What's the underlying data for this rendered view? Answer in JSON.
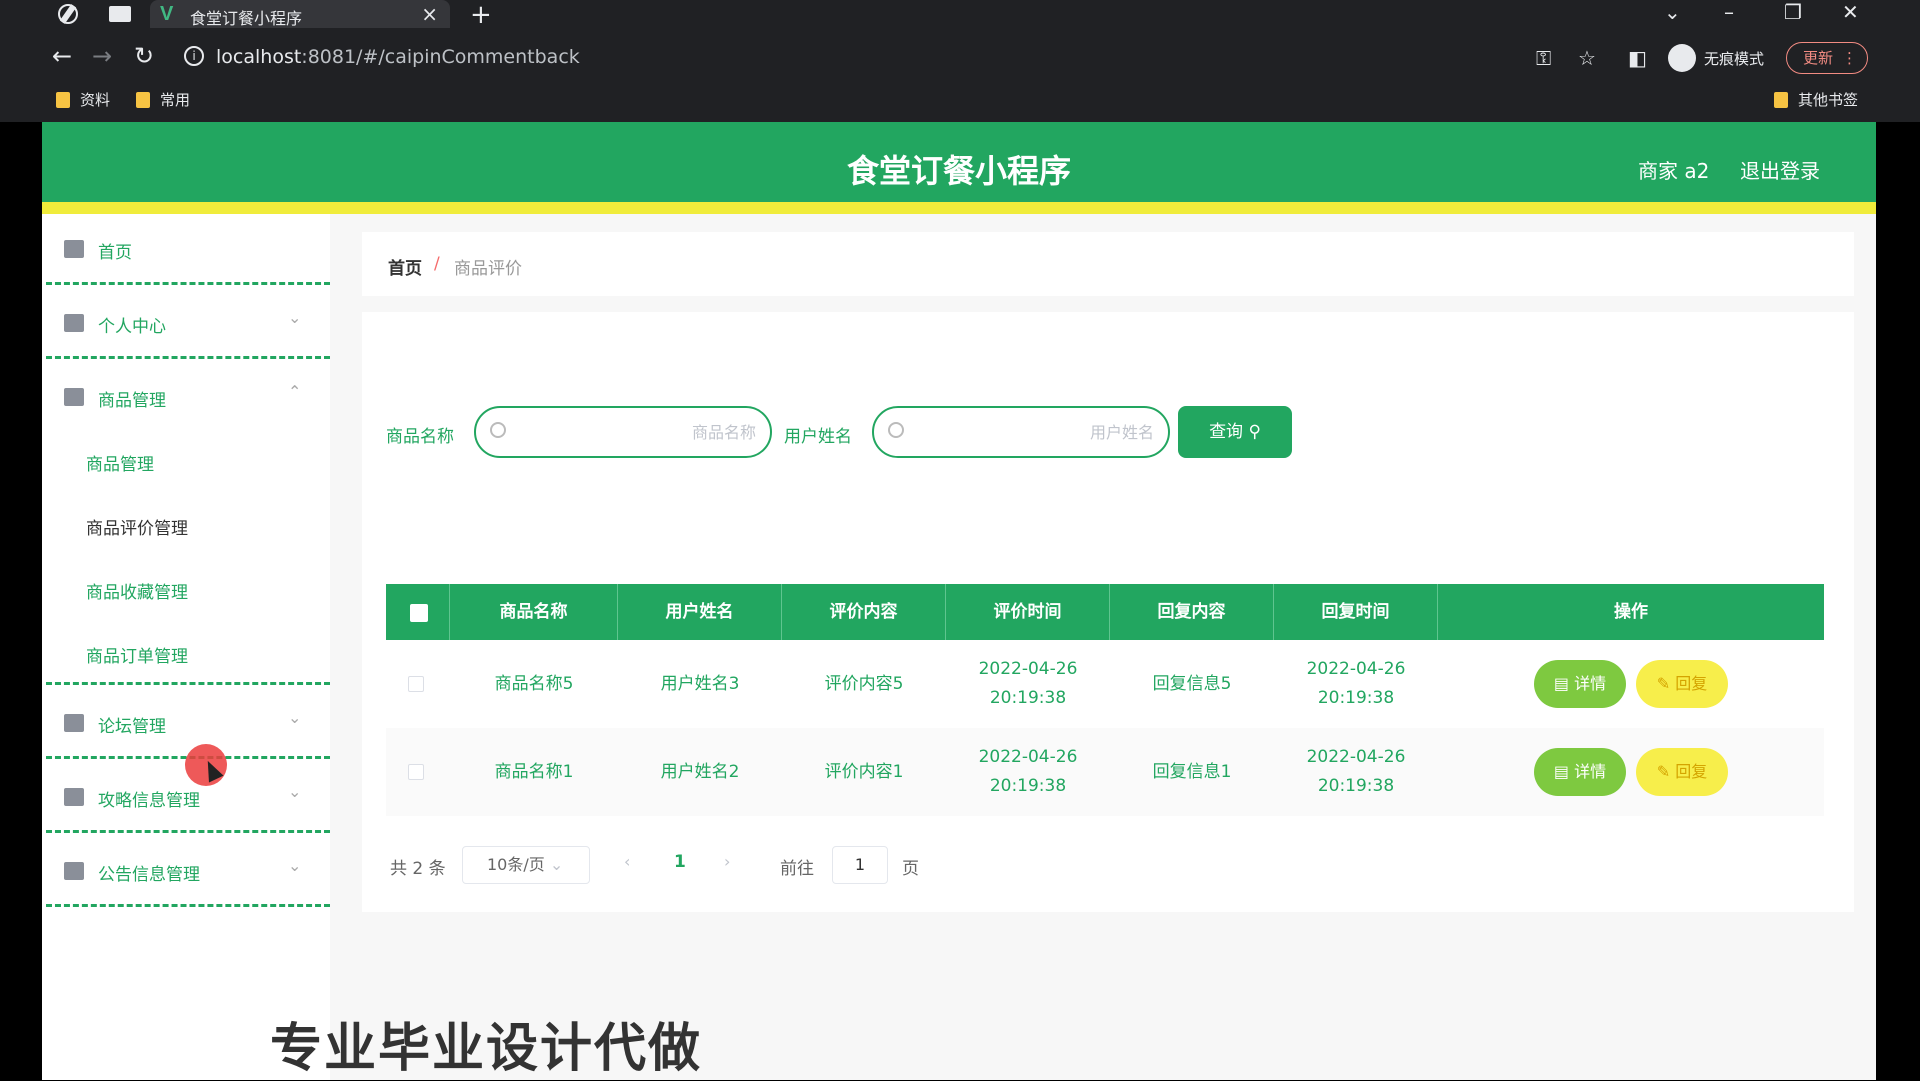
{
  "browser": {
    "tab_title": "食堂订餐小程序",
    "tab_logo": "V",
    "url_host": "localhost",
    "url_path": ":8081/#/caipinCommentback",
    "incognito_label": "无痕模式",
    "update_label": "更新",
    "bookmarks": [
      "资料",
      "常用"
    ],
    "other_bookmarks": "其他书签"
  },
  "header": {
    "title": "食堂订餐小程序",
    "user": "商家 a2",
    "logout": "退出登录"
  },
  "sidebar": {
    "home": "首页",
    "personal": "个人中心",
    "goods_mgmt": "商品管理",
    "sub_goods": "商品管理",
    "sub_review": "商品评价管理",
    "sub_favorite": "商品收藏管理",
    "sub_order": "商品订单管理",
    "forum": "论坛管理",
    "guide": "攻略信息管理",
    "notice": "公告信息管理"
  },
  "breadcrumb": {
    "home": "首页",
    "sep": "/",
    "current": "商品评价"
  },
  "search": {
    "goods_label": "商品名称",
    "goods_placeholder": "商品名称",
    "user_label": "用户姓名",
    "user_placeholder": "用户姓名",
    "query_label": "查询"
  },
  "table": {
    "headers": [
      "商品名称",
      "用户姓名",
      "评价内容",
      "评价时间",
      "回复内容",
      "回复时间",
      "操作"
    ],
    "rows": [
      {
        "goods": "商品名称5",
        "user": "用户姓名3",
        "content": "评价内容5",
        "time": "2022-04-26 20:19:38",
        "reply": "回复信息5",
        "reply_time": "2022-04-26 20:19:38"
      },
      {
        "goods": "商品名称1",
        "user": "用户姓名2",
        "content": "评价内容1",
        "time": "2022-04-26 20:19:38",
        "reply": "回复信息1",
        "reply_time": "2022-04-26 20:19:38"
      }
    ],
    "detail_label": "详情",
    "reply_label": "回复"
  },
  "pager": {
    "total": "共 2 条",
    "page_size": "10条/页",
    "current_page": "1",
    "goto": "前往",
    "goto_value": "1",
    "page_suffix": "页"
  },
  "overlay": {
    "watermark": "专业毕业设计代做"
  },
  "colors": {
    "primary": "#22a660",
    "accent_yellow": "#f0ec3b",
    "detail_btn": "#7ec940",
    "reply_btn": "#f7ee4b"
  }
}
